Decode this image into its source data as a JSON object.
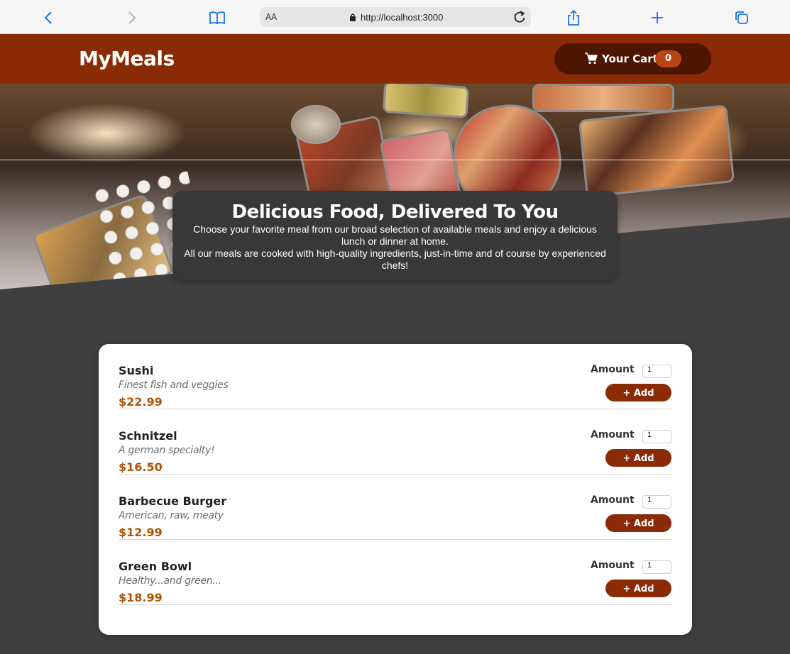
{
  "browser": {
    "text_size_label": "AA",
    "url": "http://localhost:3000"
  },
  "header": {
    "brand": "MyMeals",
    "cart_label": "Your Cart",
    "cart_count": "0"
  },
  "summary": {
    "title": "Delicious Food, Delivered To You",
    "paragraph1": "Choose your favorite meal from our broad selection of available meals and enjoy a delicious lunch or dinner at home.",
    "paragraph2": "All our meals are cooked with high-quality ingredients, just-in-time and of course by experienced chefs!"
  },
  "meals": [
    {
      "name": "Sushi",
      "description": "Finest fish and veggies",
      "price": "$22.99",
      "amount_label": "Amount",
      "amount_value": "1",
      "add_label": "+ Add"
    },
    {
      "name": "Schnitzel",
      "description": "A german specialty!",
      "price": "$16.50",
      "amount_label": "Amount",
      "amount_value": "1",
      "add_label": "+ Add"
    },
    {
      "name": "Barbecue Burger",
      "description": "American, raw, meaty",
      "price": "$12.99",
      "amount_label": "Amount",
      "amount_value": "1",
      "add_label": "+ Add"
    },
    {
      "name": "Green Bowl",
      "description": "Healthy...and green...",
      "price": "$18.99",
      "amount_label": "Amount",
      "amount_value": "1",
      "add_label": "+ Add"
    }
  ],
  "colors": {
    "header": "#8a2b06",
    "cart_button": "#4d1601",
    "badge": "#b94517",
    "price": "#ad5502",
    "page_background": "#3f3f3f"
  }
}
